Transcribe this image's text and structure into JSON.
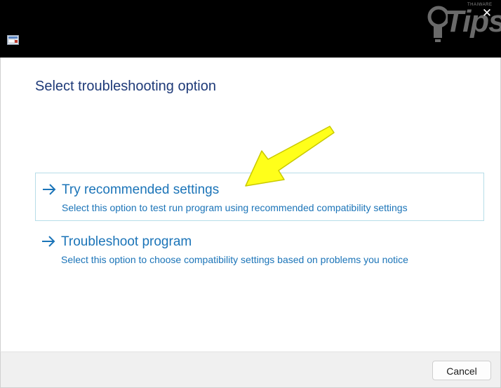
{
  "window": {
    "close_glyph": "✕",
    "app_icon": "program-compatibility-icon"
  },
  "watermark": {
    "small_text": "THAIWARE",
    "brand_text": "Tips"
  },
  "main": {
    "heading": "Select troubleshooting option",
    "options": [
      {
        "title": "Try recommended settings",
        "description": "Select this option to test run program using recommended compatibility settings",
        "selected": true,
        "icon": "arrow-right-icon"
      },
      {
        "title": "Troubleshoot program",
        "description": "Select this option to choose compatibility settings based on problems you notice",
        "selected": false,
        "icon": "arrow-right-icon"
      }
    ]
  },
  "footer": {
    "cancel_label": "Cancel"
  },
  "colors": {
    "titlebar": "#000000",
    "heading": "#1e3a78",
    "link": "#1b74b8",
    "selected_border": "#b7dde8",
    "annotation": "#ffff1a",
    "footer": "#f0f0f0"
  }
}
